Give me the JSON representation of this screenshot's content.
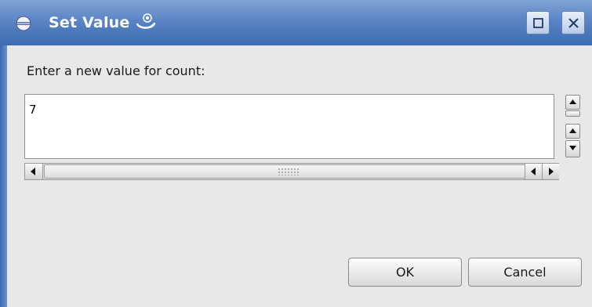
{
  "window": {
    "title": "Set Value",
    "app_icon": "eclipse-icon",
    "title_decoration_icon": "swirl-icon",
    "controls": {
      "maximize": "maximize-icon",
      "close": "close-icon"
    }
  },
  "dialog": {
    "prompt": "Enter a new value for count:",
    "value": "7"
  },
  "buttons": {
    "ok_label": "OK",
    "cancel_label": "Cancel"
  },
  "colors": {
    "titlebar": "#4b78bb",
    "dialog_bg": "#e8e8e8"
  }
}
